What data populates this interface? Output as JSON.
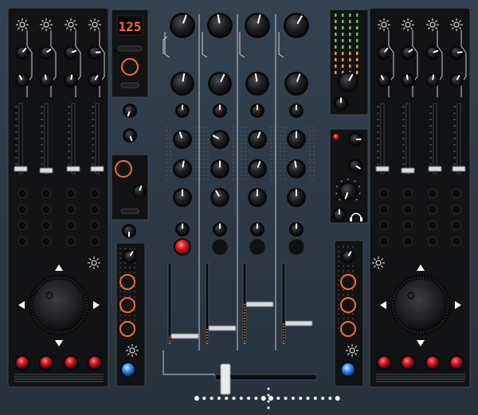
{
  "bpm": {
    "value": "125"
  },
  "theme": {
    "body": "#2e3a45",
    "panel": "#111214",
    "panel_edge": "#3e4a55",
    "knob": "#1b1c1f",
    "led_red": "#e0141d",
    "led_blue": "#2f8cff",
    "ring_orange": "#ff6a2a",
    "bpm_color": "#ff6a2a",
    "meter_green": "#5fd04a",
    "meter_orange": "#ff9a2a",
    "tick_white": "#ffffff"
  },
  "icons": {
    "bpm_display": "seven-segment-display",
    "headphones": "headphones-icon",
    "jog": "jog-wheel",
    "pad": "red-pad-button",
    "sync": "blue-led-button",
    "brightness": "sun-icon"
  }
}
